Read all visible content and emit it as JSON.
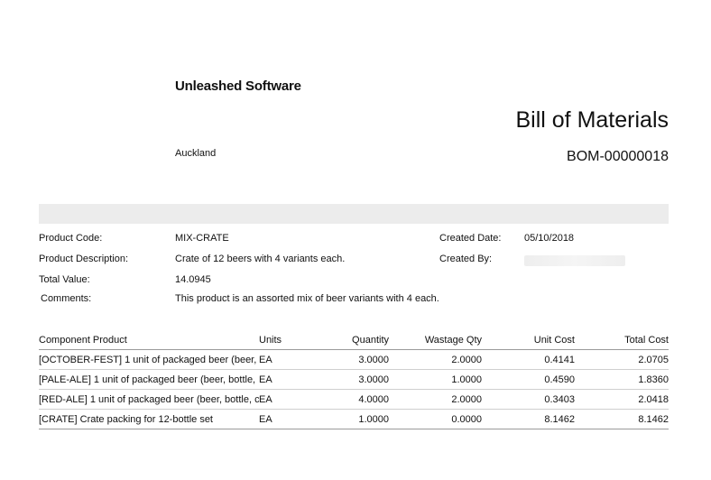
{
  "company": {
    "name": "Unleashed Software",
    "city": "Auckland"
  },
  "document": {
    "title": "Bill of Materials",
    "number": "BOM-00000018"
  },
  "details": {
    "product_code_label": "Product Code:",
    "product_code": "MIX-CRATE",
    "product_description_label": "Product Description:",
    "product_description": "Crate of 12 beers with 4 variants each.",
    "total_value_label": "Total Value:",
    "total_value": "14.0945",
    "comments_label": "Comments:",
    "comments": "This product is an assorted mix of beer variants with 4 each.",
    "created_date_label": "Created Date:",
    "created_date": "05/10/2018",
    "created_by_label": "Created By:"
  },
  "table": {
    "headers": [
      "Component Product",
      "Units",
      "Quantity",
      "Wastage Qty",
      "Unit Cost",
      "Total Cost"
    ],
    "rows": [
      [
        "[OCTOBER-FEST] 1 unit of packaged beer (beer,",
        "EA",
        "3.0000",
        "2.0000",
        "0.4141",
        "2.0705"
      ],
      [
        "[PALE-ALE] 1 unit of packaged beer (beer, bottle,",
        "EA",
        "3.0000",
        "1.0000",
        "0.4590",
        "1.8360"
      ],
      [
        "[RED-ALE] 1 unit of packaged beer (beer, bottle, c",
        "EA",
        "4.0000",
        "2.0000",
        "0.3403",
        "2.0418"
      ],
      [
        "[CRATE] Crate packing for 12-bottle set",
        "EA",
        "1.0000",
        "0.0000",
        "8.1462",
        "8.1462"
      ]
    ]
  }
}
